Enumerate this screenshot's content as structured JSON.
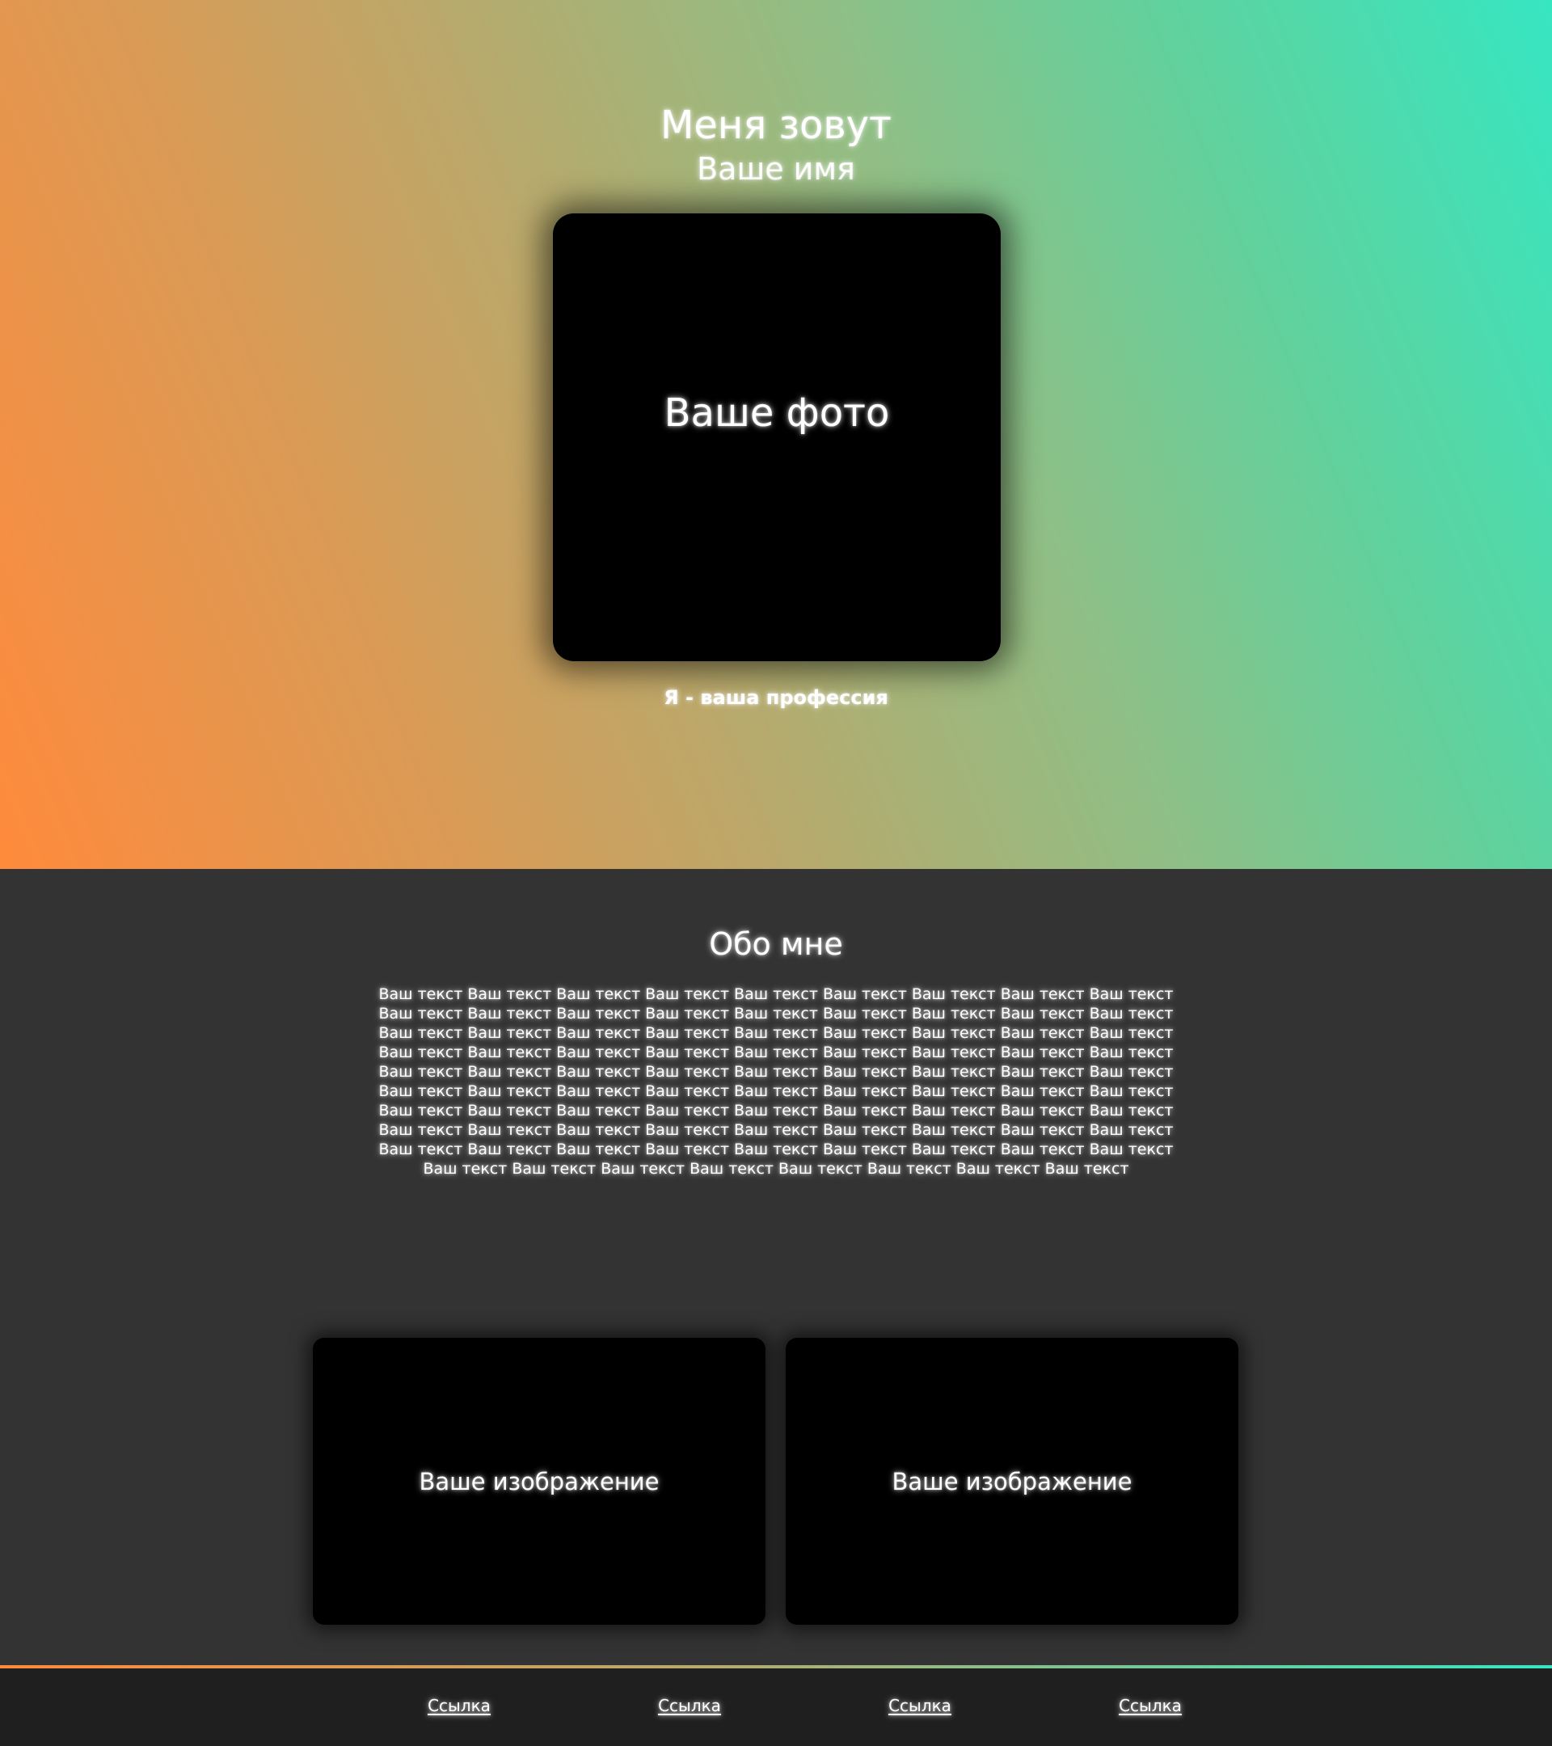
{
  "hero": {
    "title": "Меня зовут",
    "name": "Ваше имя",
    "photo_label": "Ваше фото",
    "profession": "Я - ваша профессия"
  },
  "about": {
    "title": "Обо мне",
    "text": "Ваш текст Ваш текст Ваш текст Ваш текст Ваш текст Ваш текст Ваш текст Ваш текст Ваш текст Ваш текст Ваш текст Ваш текст Ваш текст Ваш текст Ваш текст Ваш текст Ваш текст Ваш текст Ваш текст Ваш текст Ваш текст Ваш текст Ваш текст Ваш текст Ваш текст Ваш текст Ваш текст Ваш текст Ваш текст Ваш текст Ваш текст Ваш текст Ваш текст Ваш текст Ваш текст Ваш текст Ваш текст Ваш текст Ваш текст Ваш текст Ваш текст Ваш текст Ваш текст Ваш текст Ваш текст Ваш текст Ваш текст Ваш текст Ваш текст Ваш текст Ваш текст Ваш текст Ваш текст Ваш текст Ваш текст Ваш текст Ваш текст Ваш текст Ваш текст Ваш текст Ваш текст Ваш текст Ваш текст Ваш текст Ваш текст Ваш текст Ваш текст Ваш текст Ваш текст Ваш текст Ваш текст Ваш текст Ваш текст Ваш текст Ваш текст Ваш текст Ваш текст Ваш текст Ваш текст Ваш текст Ваш текст Ваш текст Ваш текст Ваш текст Ваш текст Ваш текст Ваш текст Ваш текст Ваш текст",
    "images": [
      {
        "label": "Ваше изображение"
      },
      {
        "label": "Ваше изображение"
      }
    ]
  },
  "footer": {
    "links": [
      {
        "label": "Ссылка"
      },
      {
        "label": "Ссылка"
      },
      {
        "label": "Ссылка"
      },
      {
        "label": "Ссылка"
      }
    ]
  },
  "colors": {
    "gradient_start": "#ff8a3c",
    "gradient_end": "#36e6c1",
    "section_background": "#333333",
    "footer_background": "#1f1f1f",
    "card_background": "#000000"
  }
}
